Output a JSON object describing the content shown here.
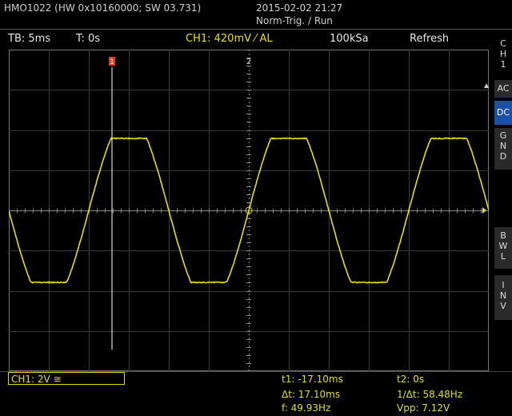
{
  "header": {
    "device": "HMO1022 (HW 0x10160000; SW 03.731)",
    "datetime": "2015-02-02 21:27",
    "trigger_mode": "Norm-Trig. / Run"
  },
  "toolbar": {
    "timebase": "TB: 5ms",
    "trigger_time": "T: 0s",
    "channel": "CH1: 420mV ⁄ AL",
    "sample_rate": "100kSa",
    "acquire_mode": "Refresh"
  },
  "screen": {
    "cursor1_label": "1",
    "cursor2_label": "2",
    "ground_marker": "1",
    "trace_color": "#e8e000"
  },
  "sidebar": {
    "channel_label": [
      "C",
      "H",
      "1"
    ],
    "buttons": [
      {
        "id": "ac",
        "lines": [
          "AC"
        ],
        "active": false
      },
      {
        "id": "dc",
        "lines": [
          "DC"
        ],
        "active": true
      },
      {
        "id": "gnd",
        "lines": [
          "G",
          "N",
          "D"
        ],
        "active": false
      },
      {
        "id": "bwl",
        "lines": [
          "B",
          "W",
          "L"
        ],
        "active": false
      },
      {
        "id": "inv",
        "lines": [
          "I",
          "N",
          "V"
        ],
        "active": false
      }
    ]
  },
  "footer": {
    "ch1_setting": "CH1: 2V ≅",
    "t1": "t1: -17.10ms",
    "t2": "t2: 0s",
    "dt": "Δt: 17.10ms",
    "inv_dt": "1/Δt: 58.48Hz",
    "freq": "f: 49.93Hz",
    "vpp": "Vpp: 7.12V"
  }
}
